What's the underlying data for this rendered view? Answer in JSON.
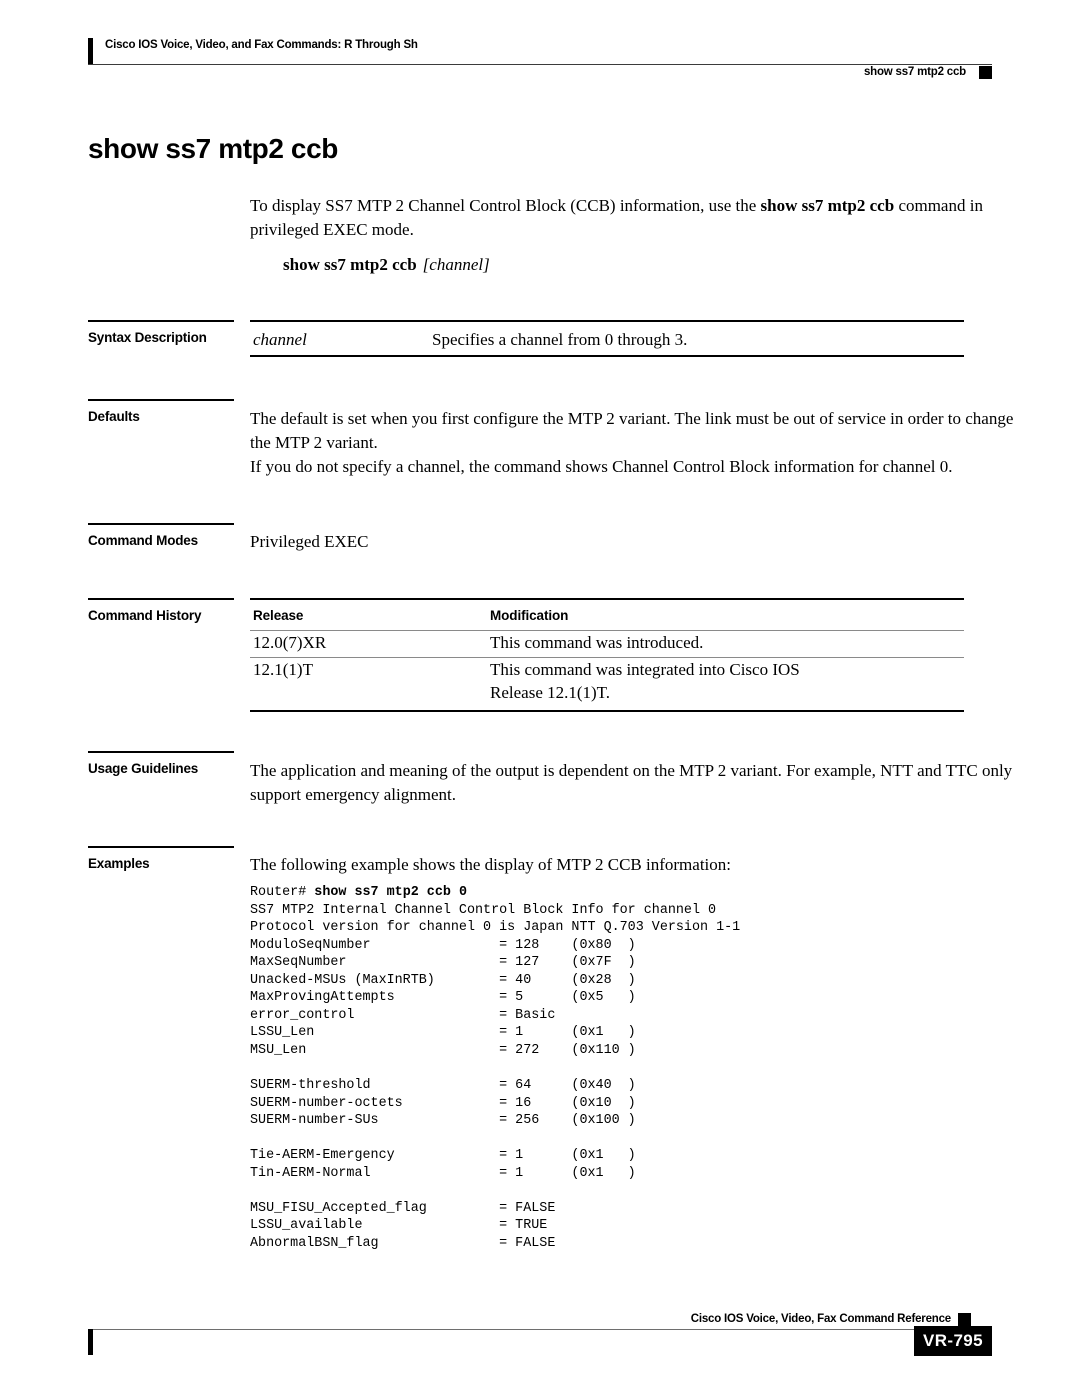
{
  "header": {
    "book_title": "Cisco IOS Voice, Video, and Fax Commands: R Through Sh",
    "running_command": "show  ss7 mtp2 ccb"
  },
  "page_title": "show  ss7 mtp2 ccb",
  "intro": {
    "text_before_bold": "To display SS7 MTP 2 Channel Control Block (CCB) information, use the ",
    "bold_command": "show ss7 mtp2 ccb",
    "text_after_bold": " command in privileged EXEC mode."
  },
  "syntax_line": {
    "command": "show ss7 mtp2 ccb",
    "argument": "[channel]"
  },
  "sections": {
    "syntax_description": {
      "label": "Syntax Description",
      "rows": [
        {
          "term": "channel",
          "description": "Specifies a channel from 0 through 3."
        }
      ]
    },
    "defaults": {
      "label": "Defaults",
      "paragraphs": [
        "The default is set when you first configure the MTP 2 variant. The link must be out of service in order to change the MTP 2 variant.",
        "If you do not specify a channel, the command shows Channel Control Block information for channel 0."
      ]
    },
    "command_modes": {
      "label": "Command Modes",
      "value": "Privileged EXEC"
    },
    "command_history": {
      "label": "Command History",
      "columns": [
        "Release",
        "Modification"
      ],
      "rows": [
        {
          "release": "12.0(7)XR",
          "modification": "This command was introduced."
        },
        {
          "release": "12.1(1)T",
          "modification_line1": "This command was integrated into Cisco IOS",
          "modification_line2": "Release 12.1(1)T."
        }
      ]
    },
    "usage_guidelines": {
      "label": "Usage Guidelines",
      "paragraph": "The application and meaning of the output is dependent on the MTP 2 variant. For example, NTT and TTC only support emergency alignment."
    },
    "examples": {
      "label": "Examples",
      "intro": "The following example shows the display of MTP 2 CCB information:",
      "prompt": "Router# ",
      "typed_command": "show ss7 mtp2 ccb 0",
      "output_lines": [
        "SS7 MTP2 Internal Channel Control Block Info for channel 0",
        "Protocol version for channel 0 is Japan NTT Q.703 Version 1-1",
        "ModuloSeqNumber                = 128    (0x80  )",
        "MaxSeqNumber                   = 127    (0x7F  )",
        "Unacked-MSUs (MaxInRTB)        = 40     (0x28  )",
        "MaxProvingAttempts             = 5      (0x5   )",
        "error_control                  = Basic",
        "LSSU_Len                       = 1      (0x1   )",
        "MSU_Len                        = 272    (0x110 )",
        "",
        "SUERM-threshold                = 64     (0x40  )",
        "SUERM-number-octets            = 16     (0x10  )",
        "SUERM-number-SUs               = 256    (0x100 )",
        "",
        "Tie-AERM-Emergency             = 1      (0x1   )",
        "Tin-AERM-Normal                = 1      (0x1   )",
        "",
        "MSU_FISU_Accepted_flag         = FALSE",
        "LSSU_available                 = TRUE",
        "AbnormalBSN_flag               = FALSE"
      ]
    }
  },
  "footer": {
    "book_reference": "Cisco IOS Voice, Video, Fax Command Reference",
    "page_number": "VR-795"
  }
}
